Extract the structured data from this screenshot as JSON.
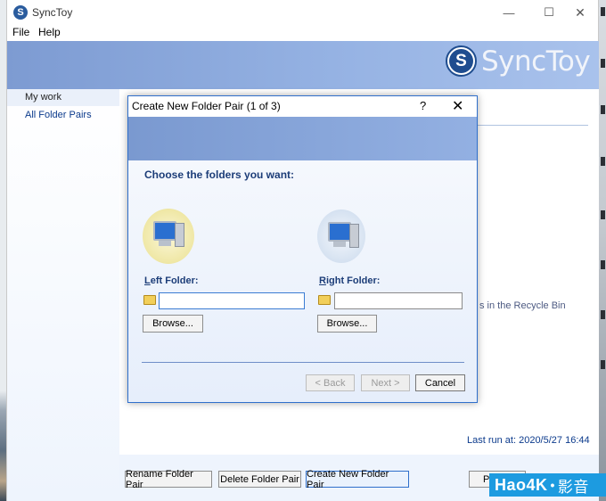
{
  "app": {
    "title": "SyncToy",
    "icon_glyph": "S",
    "window_controls": {
      "minimize": "—",
      "maximize": "☐",
      "close": "✕"
    }
  },
  "menu": {
    "file": "File",
    "help": "Help"
  },
  "banner": {
    "logo_text": "SyncToy",
    "logo_glyph": "S"
  },
  "sidebar": {
    "items": [
      {
        "label": "My work"
      },
      {
        "label": "All Folder Pairs"
      }
    ]
  },
  "content": {
    "recycle_text": "s in the Recycle Bin",
    "last_run": "Last run at: 2020/5/27 16:44"
  },
  "bottombar": {
    "rename_label": "Rename Folder Pair",
    "delete_label": "Delete Folder Pair",
    "create_label": "Create New Folder Pair",
    "preview_label": "Pr"
  },
  "watermark": {
    "brand": "Hao4K",
    "dot": "•",
    "cn": "影音"
  },
  "dialog": {
    "title": "Create New Folder Pair (1 of 3)",
    "help_glyph": "?",
    "close_glyph": "✕",
    "heading": "Choose the folders you want:",
    "left_folder": {
      "label_key": "L",
      "label_rest": "eft Folder:",
      "value": "",
      "browse_label": "Browse..."
    },
    "right_folder": {
      "label_key": "R",
      "label_rest": "ight Folder:",
      "value": "",
      "browse_label": "Browse..."
    },
    "back_label": "< Back",
    "next_label": "Next >",
    "cancel_label": "Cancel"
  },
  "colors": {
    "accent": "#2f6fcb",
    "banner": "#95b2e3",
    "heading_text": "#1c3d78",
    "link_text": "#0b3a8c",
    "watermark_bg": "#1d9be0"
  }
}
